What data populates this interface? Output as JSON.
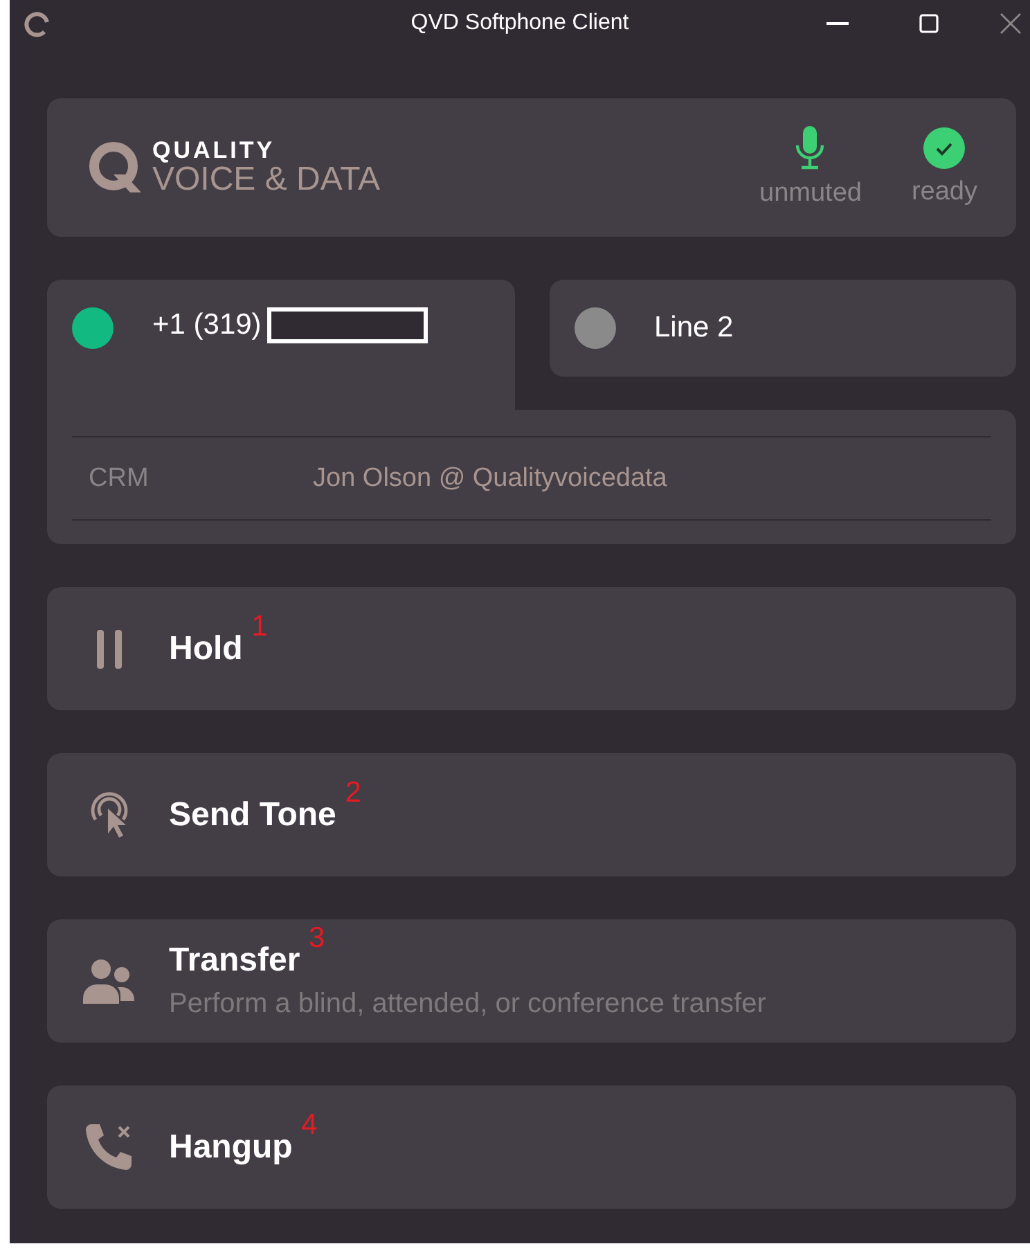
{
  "window": {
    "title": "QVD Softphone Client"
  },
  "header": {
    "logo_top": "QUALITY",
    "logo_bottom": "VOICE & DATA",
    "statuses": [
      {
        "kind": "mic",
        "label": "unmuted",
        "color": "#3ccf74"
      },
      {
        "kind": "check",
        "label": "ready",
        "color": "#3ccf74"
      }
    ]
  },
  "lines": [
    {
      "label": "+1 (319)",
      "redacted": true,
      "selected": true,
      "color": "#12b981"
    },
    {
      "label": "Line 2",
      "redacted": false,
      "selected": false,
      "color": "#8a8a8a"
    }
  ],
  "details": [
    {
      "label": "CRM",
      "value": "Jon Olson @ Qualityvoicedata"
    }
  ],
  "actions": [
    {
      "kind": "pause",
      "title": "Hold",
      "badge": "1"
    },
    {
      "kind": "tone",
      "title": "Send Tone",
      "badge": "2"
    },
    {
      "kind": "transfer",
      "title": "Transfer",
      "subtitle": "Perform a blind, attended, or conference transfer",
      "badge": "3"
    },
    {
      "kind": "hangup",
      "title": "Hangup",
      "badge": "4"
    }
  ]
}
